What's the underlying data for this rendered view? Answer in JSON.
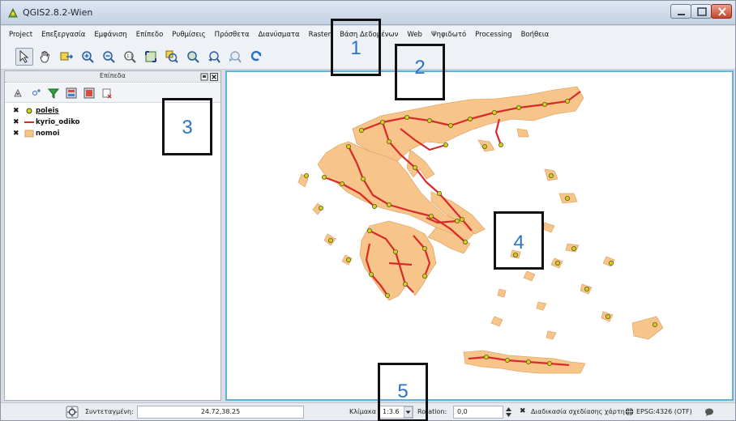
{
  "window": {
    "title": "QGIS2.8.2-Wien",
    "icon": "qgis-icon",
    "controls": [
      "minimize-icon",
      "maximize-icon",
      "close-icon"
    ]
  },
  "menu": {
    "items": [
      "Project",
      "Επεξεργασία",
      "Εμφάνιση",
      "Επίπεδο",
      "Ρυθμίσεις",
      "Πρόσθετα",
      "Διανύσματα",
      "Raster",
      "Βάση Δεδομένων",
      "Web",
      "Ψηφιδωτό",
      "Processing",
      "Βοήθεια"
    ]
  },
  "toolbar": {
    "tools": [
      "pan-arrow-icon",
      "pan-hand-icon",
      "pan-to-selection-icon",
      "zoom-in-icon",
      "zoom-out-icon",
      "zoom-actual-icon",
      "zoom-full-icon",
      "zoom-to-selection-icon",
      "zoom-to-layer-icon",
      "zoom-last-icon",
      "zoom-next-icon",
      "refresh-icon"
    ]
  },
  "layers_panel": {
    "title": "Επίπεδα",
    "tools": [
      "open-layer-styling-icon",
      "add-group-icon",
      "filter-icon",
      "expand-all-icon",
      "collapse-all-icon",
      "remove-layer-icon"
    ],
    "layers": [
      {
        "name": "poleis",
        "checked": "✖",
        "symbol": "point",
        "color": "#d4d022"
      },
      {
        "name": "kyrio_odiko",
        "checked": "✖",
        "symbol": "line",
        "color": "#d92a2a"
      },
      {
        "name": "nomoi",
        "checked": "✖",
        "symbol": "polygon",
        "color": "#f7c48a"
      }
    ]
  },
  "map": {
    "land_color": "#f7c48a",
    "road_color": "#d92a2a",
    "city_color": "#d4d022",
    "border_color": "#5fb2d8"
  },
  "status": {
    "coord_label": "Συντεταγμένη:",
    "coord_value": "24.72,38.25",
    "scale_label": "Κλίμακα",
    "scale_value": "1:3.6",
    "rotation_label": "Rotation:",
    "rotation_value": "0,0",
    "render_check": "✖",
    "render_label": "Διαδικασία σχεδίασης χάρτη",
    "crs_label": "EPSG:4326 (OTF)"
  },
  "callouts": [
    "1",
    "2",
    "3",
    "4",
    "5"
  ]
}
